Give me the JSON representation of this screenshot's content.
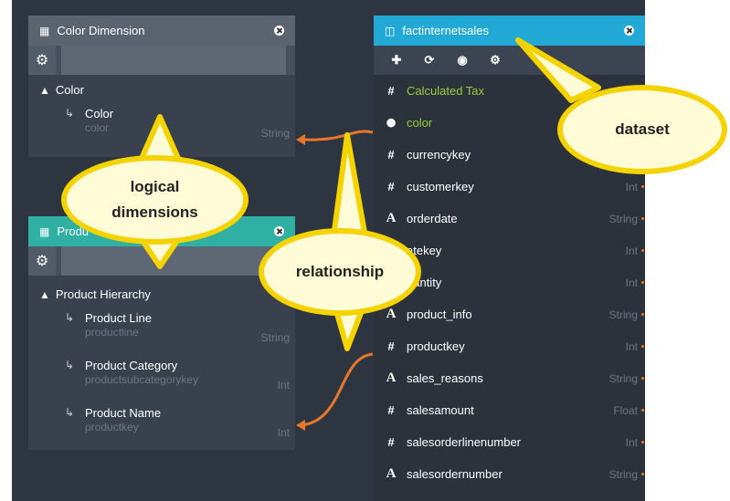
{
  "panels": {
    "color_dimension": {
      "title": "Color Dimension",
      "dimension": "Color",
      "levels": [
        {
          "name": "Color",
          "column": "color",
          "type": "String"
        }
      ]
    },
    "product_dimension": {
      "title": "Produ",
      "dimension": "Product Hierarchy",
      "levels": [
        {
          "name": "Product Line",
          "column": "productline",
          "type": "String"
        },
        {
          "name": "Product Category",
          "column": "productsubcategorykey",
          "type": "Int"
        },
        {
          "name": "Product Name",
          "column": "productkey",
          "type": "Int"
        }
      ]
    },
    "dataset": {
      "title": "factinternetsales",
      "fields": [
        {
          "icon": "#",
          "name": "Calculated Tax",
          "type": ""
        },
        {
          "icon": "pin",
          "name": "color",
          "type": ""
        },
        {
          "icon": "#",
          "name": "currencykey",
          "type": ""
        },
        {
          "icon": "#",
          "name": "customerkey",
          "type": "Int"
        },
        {
          "icon": "A",
          "name": "orderdate",
          "type": "String"
        },
        {
          "icon": "#",
          "name": "atekey",
          "type": "Int"
        },
        {
          "icon": "#",
          "name": "uantity",
          "type": "Int"
        },
        {
          "icon": "A",
          "name": "product_info",
          "type": "String"
        },
        {
          "icon": "#",
          "name": "productkey",
          "type": "Int"
        },
        {
          "icon": "A",
          "name": "sales_reasons",
          "type": "String"
        },
        {
          "icon": "#",
          "name": "salesamount",
          "type": "Float"
        },
        {
          "icon": "#",
          "name": "salesorderlinenumber",
          "type": "Int"
        },
        {
          "icon": "A",
          "name": "salesordernumber",
          "type": "String"
        }
      ]
    }
  },
  "callouts": {
    "logical": "logical dimensions",
    "relationship": "relationship",
    "dataset": "dataset"
  },
  "colors": {
    "canvas": "#2d3540",
    "teal": "#2fb0a3",
    "blue": "#22a9d6",
    "relation": "#e8772e",
    "callout_border": "#f5d300",
    "callout_fill": "#fffbd6"
  }
}
